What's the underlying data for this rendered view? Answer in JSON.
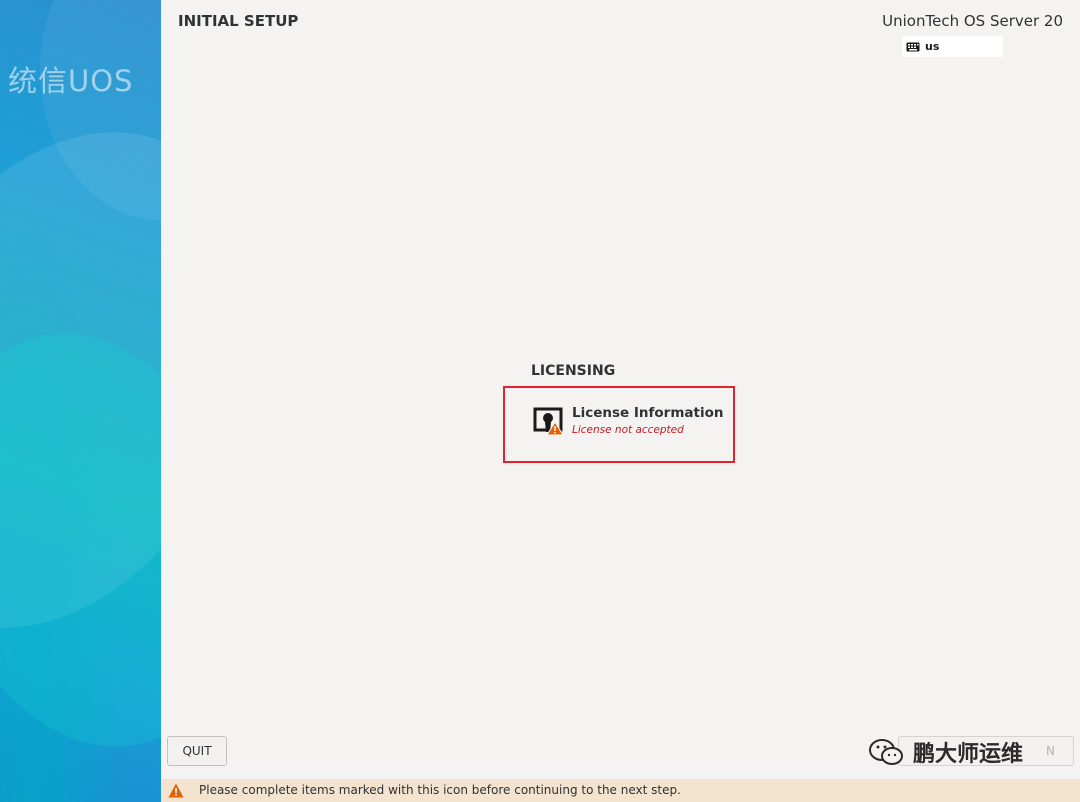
{
  "sidebar": {
    "logo_text": "统信UOS"
  },
  "header": {
    "title": "INITIAL SETUP",
    "product": "UnionTech OS Server 20",
    "keyboard_layout": "us"
  },
  "hub": {
    "category": "LICENSING",
    "spokes": [
      {
        "name": "License Information",
        "status": "License not accepted",
        "status_color": "#c01c28"
      }
    ]
  },
  "buttons": {
    "quit": "QUIT",
    "finish_partial": "N"
  },
  "watermark": {
    "text": "鹏大师运维"
  },
  "warning_bar": {
    "text": "Please complete items marked with this icon before continuing to the next step.",
    "background": "#f3e3cf",
    "icon_color": "#e66100"
  },
  "highlight": {
    "color": "#e0232f"
  }
}
